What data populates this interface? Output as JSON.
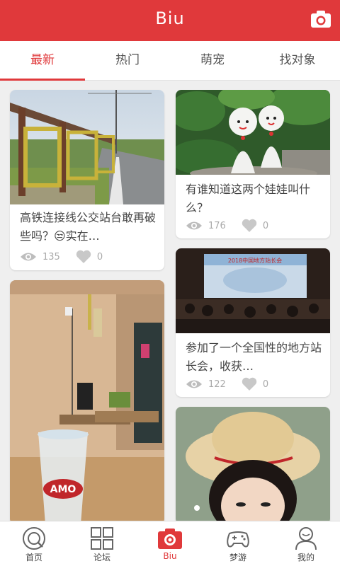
{
  "header": {
    "title": "Biu",
    "camera_icon": "camera-icon"
  },
  "tabs": [
    {
      "label": "最新",
      "active": true
    },
    {
      "label": "热门",
      "active": false
    },
    {
      "label": "萌宠",
      "active": false
    },
    {
      "label": "找对象",
      "active": false
    }
  ],
  "feed": [
    {
      "caption": "高铁连接线公交站台敢再破些吗？😒实在…",
      "views": "135",
      "likes": "0"
    },
    {
      "caption": "有谁知道这两个娃娃叫什么？",
      "views": "176",
      "likes": "0"
    },
    {
      "caption": "参加了一个全国性的地方站长会，收获…",
      "views": "122",
      "likes": "0",
      "banner_text": "2018中国地方站长会"
    },
    {
      "caption": "",
      "views": "",
      "likes": ""
    },
    {
      "caption": "",
      "views": "",
      "likes": ""
    }
  ],
  "bottom_nav": [
    {
      "label": "首页",
      "icon": "home-icon",
      "active": false
    },
    {
      "label": "论坛",
      "icon": "grid-icon",
      "active": false
    },
    {
      "label": "Biu",
      "icon": "camera-icon",
      "active": true
    },
    {
      "label": "梦游",
      "icon": "gamepad-icon",
      "active": false
    },
    {
      "label": "我的",
      "icon": "user-icon",
      "active": false
    }
  ],
  "colors": {
    "accent": "#e0393b",
    "background": "#efefef",
    "muted": "#aaaaaa"
  }
}
